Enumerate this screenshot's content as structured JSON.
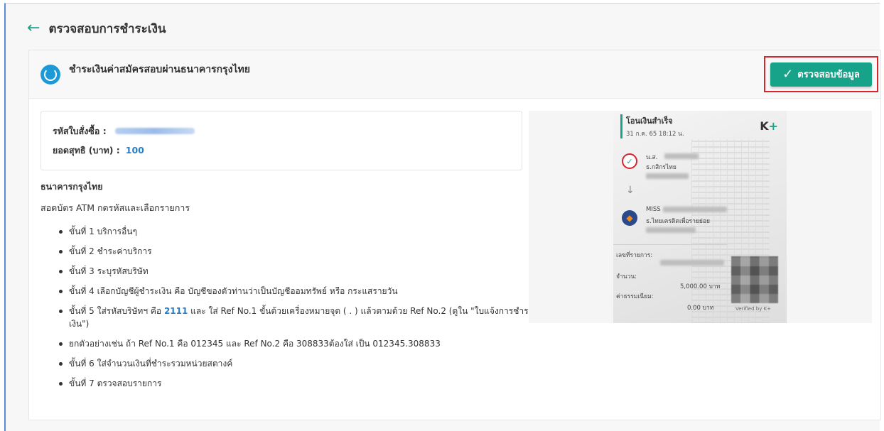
{
  "page": {
    "title": "ตรวจสอบการชำระเงิน"
  },
  "card": {
    "header_title": "ชำระเงินค่าสมัครสอบผ่านธนาคารกรุงไทย",
    "verify_button": "ตรวจสอบข้อมูล"
  },
  "summary": {
    "order_label": "รหัสใบสั่งซื้อ :",
    "net_label": "ยอดสุทธิ (บาท) :",
    "net_value": "100"
  },
  "instructions": {
    "bank_name": "ธนาคารกรุงไทย",
    "intro": "สอดบัตร ATM กดรหัสและเลือกรายการ",
    "step1": "ขั้นที่ 1 บริการอื่นๆ",
    "step2": "ขั้นที่ 2 ชำระค่าบริการ",
    "step3": "ขั้นที่ 3 ระบุรหัสบริษัท",
    "step4": "ขั้นที่ 4 เลือกบัญชีผู้ชำระเงิน คือ บัญชีของตัวท่านว่าเป็นบัญชีออมทรัพย์ หรือ กระแสรายวัน",
    "step5_a": "ขั้นที่ 5 ใส่รหัสบริษัทฯ คือ ",
    "step5_code": "2111",
    "step5_b": " และ ใส่ Ref No.1 ขั้นด้วยเครื่องหมายจุด ( . ) แล้วตามด้วย Ref No.2 (ดูใน \"ใบแจ้งการชำระเงิน\")",
    "example": "ยกตัวอย่างเช่น ถ้า Ref No.1 คือ 012345 และ Ref No.2 คือ 308833ต้องใส่ เป็น 012345.308833",
    "step6": "ขั้นที่ 6 ใส่จำนวนเงินที่ชำระรวมหน่วยสตางค์",
    "step7": "ขั้นที่ 7 ตรวจสอบรายการ"
  },
  "slip": {
    "status": "โอนเงินสำเร็จ",
    "datetime": "31 ก.ค. 65  18:12 น.",
    "brand": "K",
    "brand_plus": "+",
    "sender_prefix": "น.ส.",
    "sender_bank": "ธ.กสิกรไทย",
    "receiver_prefix": "MISS",
    "receiver_bank": "ธ.ไทยเครดิตเพื่อรายย่อย",
    "ref_label": "เลขที่รายการ:",
    "amount_label": "จำนวน:",
    "amount_value": "5,000.00 บาท",
    "fee_label": "ค่าธรรมเนียม:",
    "fee_value": "0.00 บาท",
    "verified": "Verified by K+"
  },
  "colors": {
    "accent": "#16a389",
    "highlight_border": "#d9232d",
    "link_blue": "#2a7fc9"
  }
}
